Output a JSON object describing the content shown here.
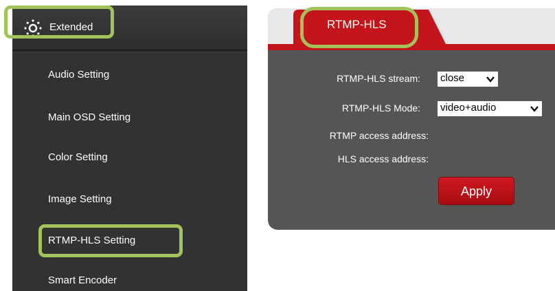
{
  "sidebar": {
    "header": {
      "label": "Extended",
      "icon": "gear-icon"
    },
    "items": [
      {
        "label": "Audio Setting"
      },
      {
        "label": "Main OSD Setting"
      },
      {
        "label": "Color Setting"
      },
      {
        "label": "Image Setting"
      },
      {
        "label": "RTMP-HLS Setting"
      },
      {
        "label": "Smart Encoder"
      }
    ]
  },
  "tab": {
    "label": "RTMP-HLS"
  },
  "form": {
    "stream_label": "RTMP-HLS stream:",
    "stream_value": "close",
    "mode_label": "RTMP-HLS Mode:",
    "mode_value": "video+audio",
    "rtmp_label": "RTMP access address:",
    "hls_label": "HLS access address:",
    "apply_label": "Apply"
  },
  "colors": {
    "accent_red": "#c4141c",
    "highlight_green": "#a4c25c",
    "sidebar_bg": "#323232",
    "panel_bg": "#555555"
  }
}
